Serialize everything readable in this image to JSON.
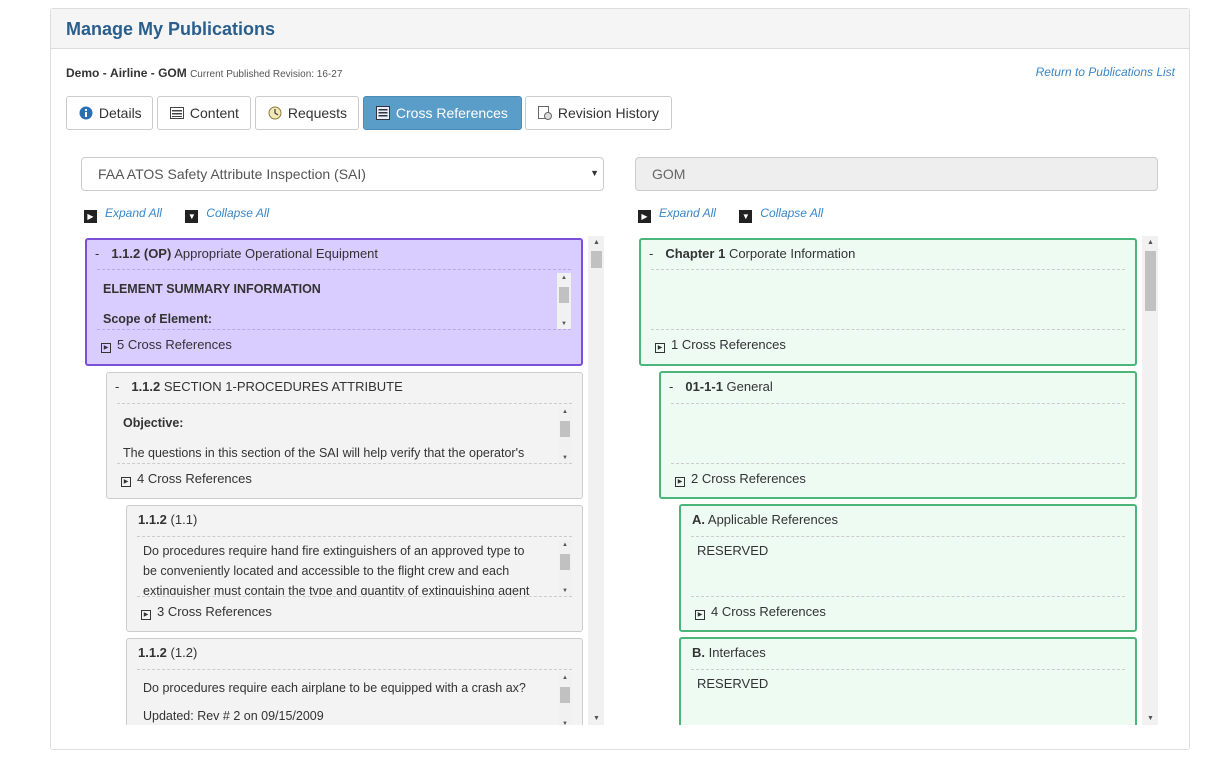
{
  "header": {
    "title": "Manage My Publications"
  },
  "publication": {
    "org": "Demo",
    "sep1": "-",
    "airline": "Airline",
    "sep2": "-",
    "code": "GOM",
    "revision_text": "Current Published Revision: 16-27",
    "return_link": "Return to Publications List"
  },
  "tabs": [
    {
      "label": "Details",
      "icon": "info-icon"
    },
    {
      "label": "Content",
      "icon": "content-icon"
    },
    {
      "label": "Requests",
      "icon": "requests-icon"
    },
    {
      "label": "Cross References",
      "icon": "cross-references-icon",
      "active": true
    },
    {
      "label": "Revision History",
      "icon": "revision-history-icon"
    }
  ],
  "left": {
    "selected": "FAA ATOS Safety Attribute Inspection (SAI)",
    "expand_all": "Expand All",
    "collapse_all": "Collapse All",
    "nodes": [
      {
        "num": "1.1.2 (OP)",
        "name": "Appropriate Operational Equipment",
        "body": [
          "ELEMENT SUMMARY INFORMATION",
          "Scope of Element:"
        ],
        "xref": "5 Cross References"
      },
      {
        "num": "1.1.2",
        "name": "SECTION 1-PROCEDURES ATTRIBUTE",
        "body": [
          "Objective:",
          "The questions in this section of the SAI will help verify that the operator's"
        ],
        "xref": "4 Cross References"
      },
      {
        "num": "1.1.2",
        "name": "(1.1)",
        "body": [
          "Do procedures require hand fire extinguishers of an approved type to",
          "be conveniently located and accessible to the flight crew and each",
          "extinguisher must contain the type and quantity of extinguishing agent"
        ],
        "xref": "3 Cross References"
      },
      {
        "num": "1.1.2",
        "name": "(1.2)",
        "body": [
          "Do procedures require each airplane to be equipped with a crash ax?",
          "Updated: Rev # 2 on 09/15/2009"
        ],
        "xref": ""
      }
    ]
  },
  "right": {
    "selected": "GOM",
    "expand_all": "Expand All",
    "collapse_all": "Collapse All",
    "nodes": [
      {
        "num": "Chapter 1",
        "name": "Corporate Information",
        "body": [],
        "xref": "1 Cross References"
      },
      {
        "num": "01-1-1",
        "name": "General",
        "body": [],
        "xref": "2 Cross References"
      },
      {
        "num": "A.",
        "name": "Applicable References",
        "body": [
          "RESERVED"
        ],
        "xref": "4 Cross References"
      },
      {
        "num": "B.",
        "name": "Interfaces",
        "body": [
          "RESERVED"
        ],
        "xref": ""
      }
    ]
  },
  "colors": {
    "accent": "#2a5e8c",
    "active_tab": "#5b9dc9",
    "link": "#3a87c8",
    "selected_left": "#d9ccff",
    "selected_left_border": "#7b4fd6",
    "right_node": "#eefbf3",
    "right_border": "#4bb57a"
  }
}
